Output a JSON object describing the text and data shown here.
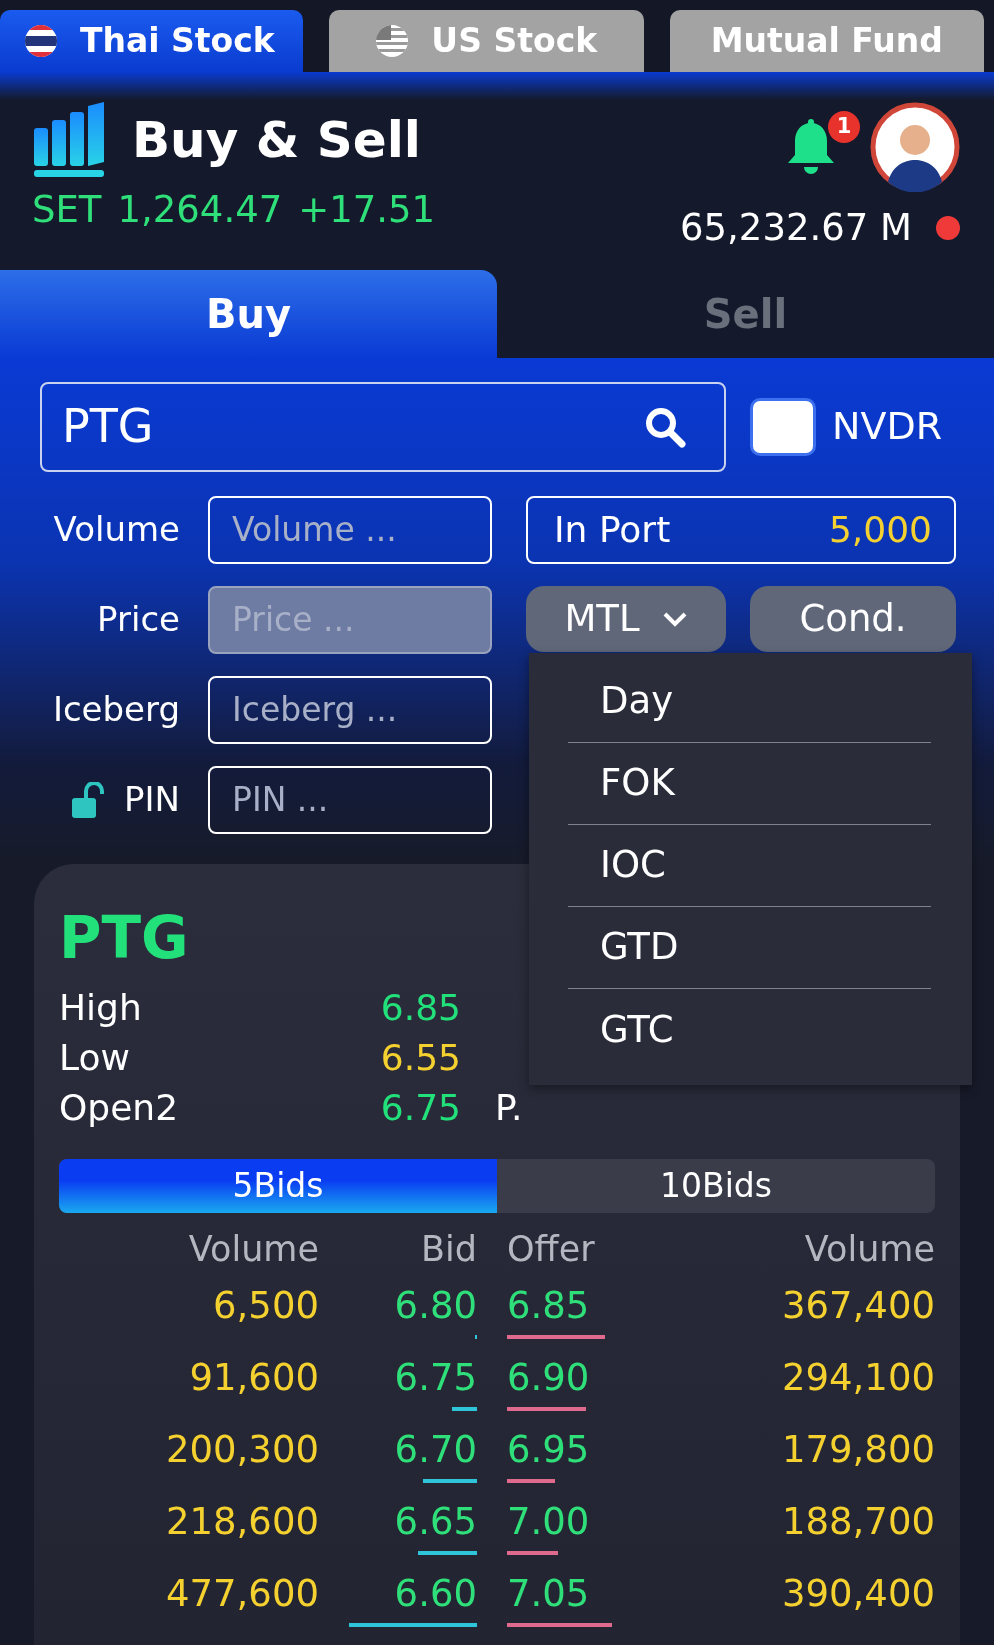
{
  "market_tabs": [
    {
      "label": "Thai Stock",
      "selected": true,
      "kind": "thai"
    },
    {
      "label": "US Stock",
      "selected": false,
      "kind": "us"
    },
    {
      "label": "Mutual Fund",
      "selected": false,
      "kind": "none"
    }
  ],
  "header": {
    "title": "Buy & Sell",
    "index_name": "SET",
    "index_value": "1,264.47",
    "index_change": "+17.51",
    "notification_count": "1",
    "balance": "65,232.67 M"
  },
  "side_tabs": [
    {
      "label": "Buy",
      "selected": true
    },
    {
      "label": "Sell",
      "selected": false
    }
  ],
  "search": {
    "value": "PTG"
  },
  "nvdr": {
    "label": "NVDR",
    "checked": false
  },
  "fields": [
    {
      "label": "Volume",
      "placeholder": "Volume ...",
      "disabled": false,
      "kind": "plain"
    },
    {
      "label": "Price",
      "placeholder": "Price ...",
      "disabled": true,
      "kind": "plain"
    },
    {
      "label": "Iceberg",
      "placeholder": "Iceberg ...",
      "disabled": false,
      "kind": "plain"
    },
    {
      "label": "PIN",
      "placeholder": "PIN ...",
      "disabled": false,
      "kind": "pin"
    }
  ],
  "in_port": {
    "label": "In Port",
    "value": "5,000"
  },
  "order_type": {
    "value": "MTL",
    "expanded": true
  },
  "cond_button": "Cond.",
  "validity_options": [
    "Day",
    "FOK",
    "IOC",
    "GTD",
    "GTC"
  ],
  "quote": {
    "symbol": "PTG",
    "stats": [
      {
        "label": "High",
        "value": "6.85",
        "color": "#22e07a"
      },
      {
        "label": "Low",
        "value": "6.55",
        "color": "#f5d130"
      },
      {
        "label": "Open2",
        "value": "6.75",
        "color": "#22e07a",
        "right_label": "P."
      }
    ]
  },
  "depth_tabs": [
    {
      "label": "5Bids",
      "selected": true
    },
    {
      "label": "10Bids",
      "selected": false
    }
  ],
  "depth_columns": [
    "Volume",
    "Bid",
    "Offer",
    "Volume"
  ],
  "depth_rows": [
    {
      "bid": {
        "volume": "6,500",
        "price": "6.80"
      },
      "offer": {
        "price": "6.85",
        "volume": "367,400"
      }
    },
    {
      "bid": {
        "volume": "91,600",
        "price": "6.75"
      },
      "offer": {
        "price": "6.90",
        "volume": "294,100"
      }
    },
    {
      "bid": {
        "volume": "200,300",
        "price": "6.70"
      },
      "offer": {
        "price": "6.95",
        "volume": "179,800"
      }
    },
    {
      "bid": {
        "volume": "218,600",
        "price": "6.65"
      },
      "offer": {
        "price": "7.00",
        "volume": "188,700"
      }
    },
    {
      "bid": {
        "volume": "477,600",
        "price": "6.60"
      },
      "offer": {
        "price": "7.05",
        "volume": "390,400"
      }
    }
  ]
}
